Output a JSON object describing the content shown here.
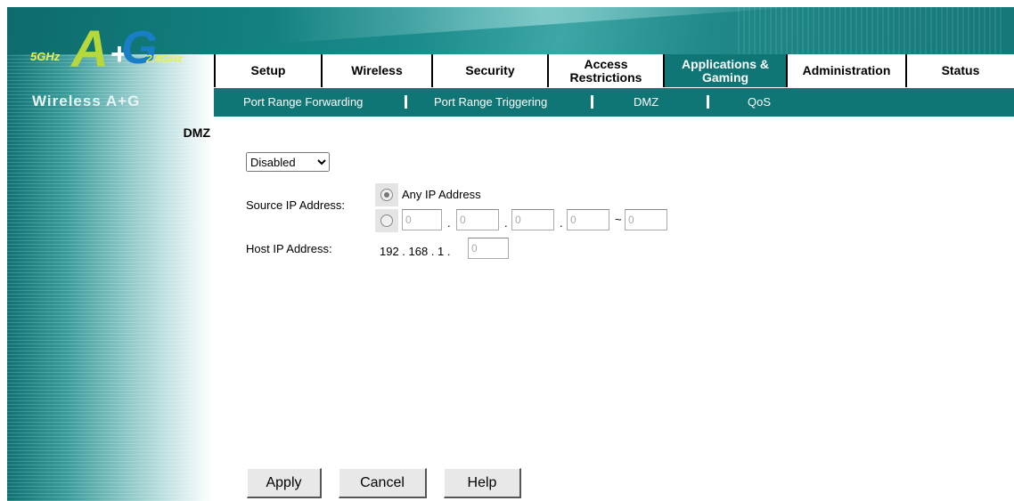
{
  "logo": {
    "ghz_5": "5GHz",
    "letter_a": "A",
    "plus": "+",
    "letter_g": "G",
    "ghz_24": "2.4GHz",
    "brand": "Wireless A+G"
  },
  "tabs": [
    {
      "label": "Setup"
    },
    {
      "label": "Wireless"
    },
    {
      "label": "Security"
    },
    {
      "label": "Access Restrictions"
    },
    {
      "label": "Applications & Gaming",
      "active": true
    },
    {
      "label": "Administration"
    },
    {
      "label": "Status"
    }
  ],
  "subnav": [
    "Port Range Forwarding",
    "Port Range Triggering",
    "DMZ",
    "QoS"
  ],
  "section_title": "DMZ",
  "dmz": {
    "state": "Disabled",
    "source_ip_label": "Source IP Address:",
    "any_ip_label": "Any IP Address",
    "range_fields": [
      "0",
      "0",
      "0",
      "0",
      "0"
    ],
    "dot": ".",
    "tilde": "~",
    "host_ip_label": "Host IP Address:",
    "host_ip_prefix": "192 . 168 . 1 .",
    "host_ip_last": "0"
  },
  "buttons": {
    "apply": "Apply",
    "cancel": "Cancel",
    "help": "Help"
  }
}
